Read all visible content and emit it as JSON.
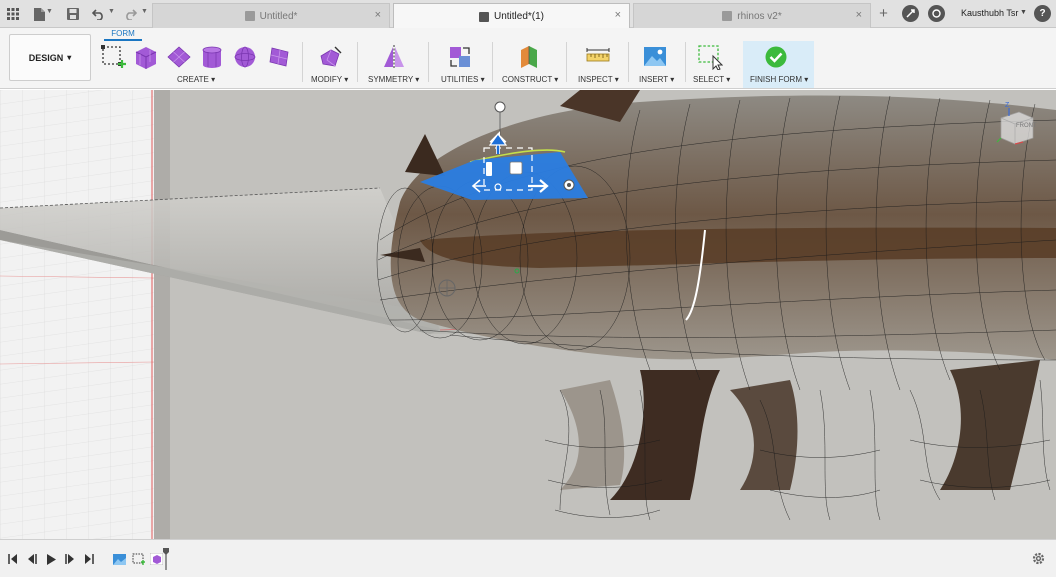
{
  "titlebar": {
    "tabs": [
      {
        "label": "Untitled*",
        "active": false
      },
      {
        "label": "Untitled*(1)",
        "active": true
      },
      {
        "label": "rhinos v2*",
        "active": false
      }
    ],
    "user_name": "Kausthubh Tsr",
    "close_glyph": "×",
    "add_tab_glyph": "+",
    "help_glyph": "?"
  },
  "ribbon": {
    "workspace_label": "DESIGN",
    "workspace_caret": "▾",
    "mode_tab_label": "FORM",
    "menus": [
      {
        "id": "create",
        "label": "CREATE ▾"
      },
      {
        "id": "modify",
        "label": "MODIFY ▾"
      },
      {
        "id": "symmetry",
        "label": "SYMMETRY ▾"
      },
      {
        "id": "utilities",
        "label": "UTILITIES ▾"
      },
      {
        "id": "construct",
        "label": "CONSTRUCT ▾"
      },
      {
        "id": "inspect",
        "label": "INSPECT ▾"
      },
      {
        "id": "insert",
        "label": "INSERT ▾"
      },
      {
        "id": "select",
        "label": "SELECT ▾"
      },
      {
        "id": "finish",
        "label": "FINISH FORM ▾"
      }
    ]
  },
  "viewport": {
    "viewcube_label": "FRONT",
    "viewcube_axis": "Z"
  },
  "colors": {
    "accent": "#1a76c2",
    "form_purple": "#a25ad6",
    "finish_green": "#3cba3c",
    "selection_blue": "#2a7de2"
  },
  "icons": {
    "apps": "grid-icon",
    "file": "file-icon",
    "save": "save-icon",
    "undo": "undo-icon",
    "redo": "redo-icon",
    "settings": "gear-icon"
  }
}
